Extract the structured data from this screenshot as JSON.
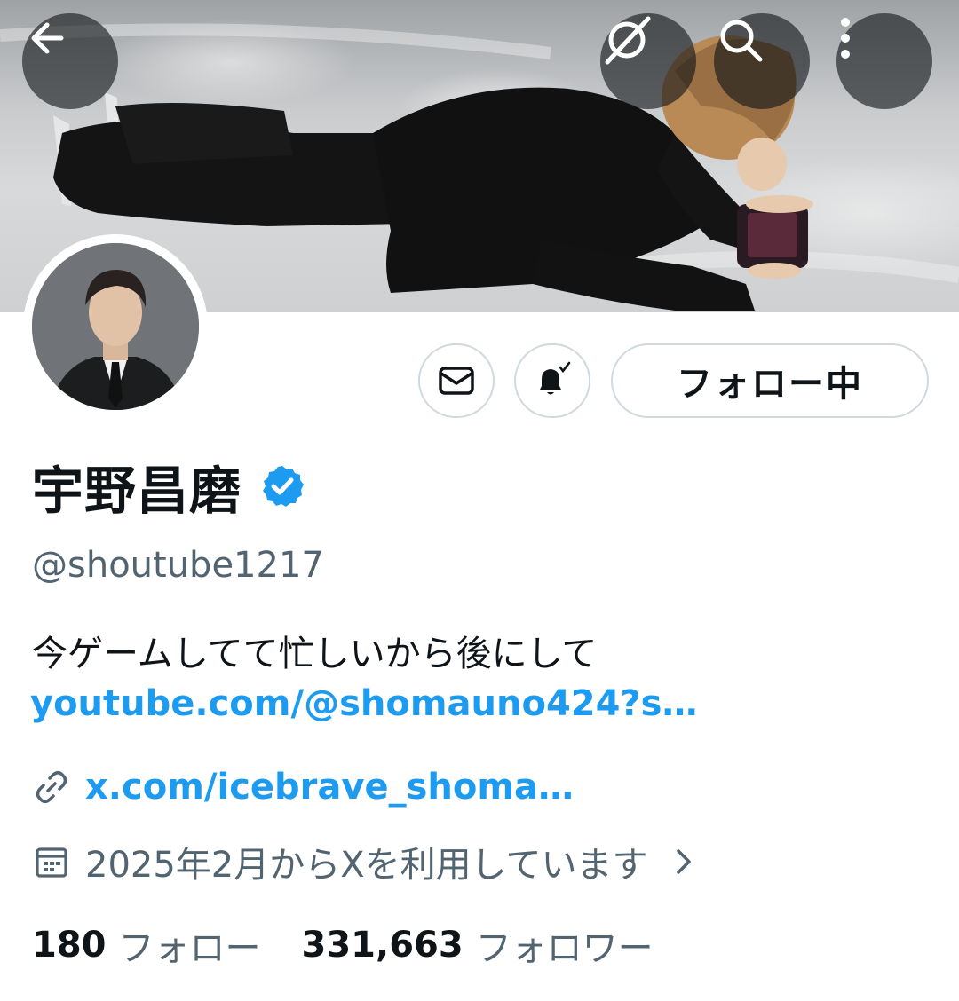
{
  "header": {
    "follow_state_label": "フォロー中"
  },
  "profile": {
    "display_name": "宇野昌磨",
    "verified": true,
    "handle": "@shoutube1217",
    "bio": "今ゲームしてて忙しいから後にして",
    "bio_link": "youtube.com/@shomauno424?s…",
    "website": "x.com/icebrave_shoma…",
    "joined": "2025年2月からXを利用しています",
    "following_count": "180",
    "following_label": "フォロー",
    "followers_count": "331,663",
    "followers_label": "フォロワー"
  },
  "colors": {
    "accent": "#1d9bf0",
    "secondary_text": "#536471",
    "border": "#cfd9de"
  },
  "icons": [
    "back-arrow-icon",
    "grok-icon",
    "search-icon",
    "more-vertical-icon",
    "mail-icon",
    "bell-check-icon",
    "verified-badge-icon",
    "link-icon",
    "calendar-icon",
    "chevron-right-icon"
  ]
}
